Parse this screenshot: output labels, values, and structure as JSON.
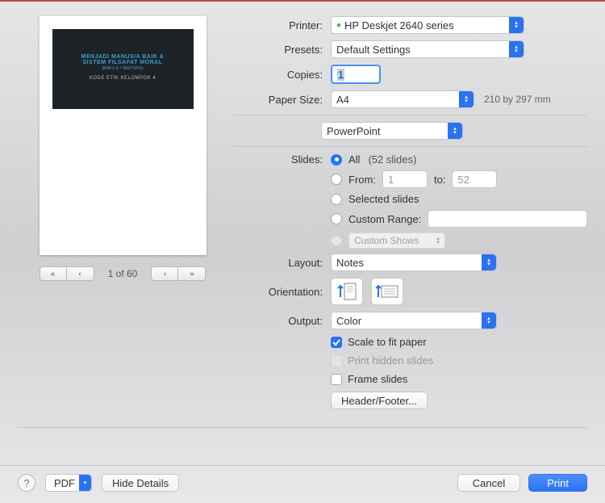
{
  "labels": {
    "printer": "Printer:",
    "presets": "Presets:",
    "copies": "Copies:",
    "paper_size": "Paper Size:",
    "slides": "Slides:",
    "layout": "Layout:",
    "orientation": "Orientation:",
    "output": "Output:"
  },
  "printer": {
    "value": "HP Deskjet 2640 series",
    "icon_status": "●"
  },
  "presets": {
    "value": "Default Settings"
  },
  "copies": {
    "value": "1"
  },
  "paper_size": {
    "value": "A4",
    "dimensions": "210 by 297 mm"
  },
  "app_section": {
    "value": "PowerPoint"
  },
  "slides_options": {
    "all_label": "All",
    "all_count": "(52 slides)",
    "from_label": "From:",
    "from_value": "1",
    "to_label": "to:",
    "to_value": "52",
    "selected_label": "Selected slides",
    "custom_range_label": "Custom Range:",
    "custom_range_value": "",
    "custom_shows_label": "Custom Shows"
  },
  "layout": {
    "value": "Notes"
  },
  "output": {
    "value": "Color"
  },
  "checks": {
    "scale": "Scale to fit paper",
    "hidden": "Print hidden slides",
    "frame": "Frame slides"
  },
  "header_footer_btn": "Header/Footer...",
  "preview": {
    "page_indicator": "1 of 60",
    "slide_title1": "MENJADI MANUSIA BAIK &",
    "slide_title2": "SISTEM FILSAFAT MORAL",
    "slide_title2b": "(BAB 6 & 7 BERTENS)",
    "slide_sub": "KODE ETIK KELOMPOK 4",
    "meta_left": "",
    "meta_right": ""
  },
  "bottom": {
    "pdf": "PDF",
    "hide_details": "Hide Details",
    "cancel": "Cancel",
    "print": "Print"
  }
}
